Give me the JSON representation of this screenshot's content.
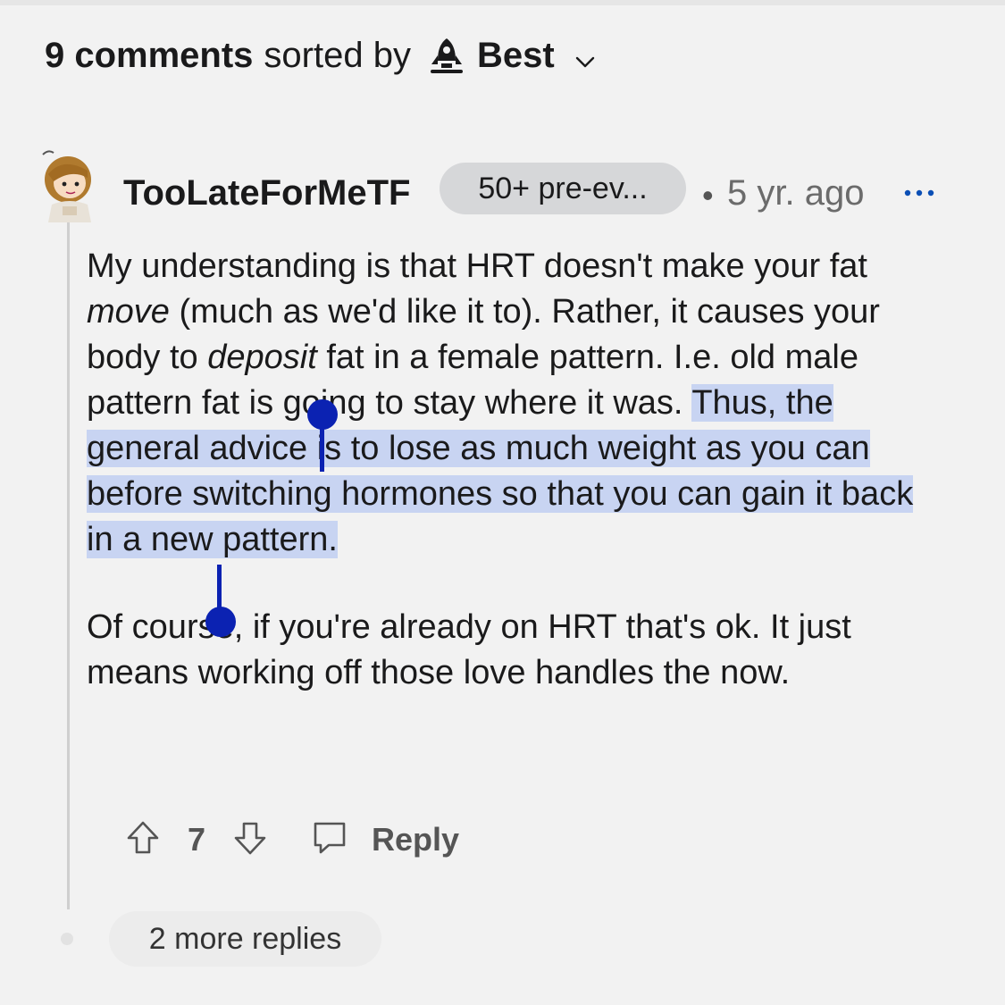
{
  "sort": {
    "count_label": "9 comments",
    "sorted_by_label": "sorted by",
    "icon": "rocket-icon",
    "value": "Best"
  },
  "comment": {
    "author": "TooLateForMeTF",
    "flair": "50+ pre-ev...",
    "separator": "•",
    "timestamp": "5 yr. ago",
    "body": {
      "p1_a": "My understanding is that HRT doesn't make your fat ",
      "p1_b": "move",
      "p1_c": " (much as we'd like it to). Rather, it causes your body to ",
      "p1_d": "deposit",
      "p1_e": " fat in a female pattern. I.e. old male pattern fat is going to stay where it was. ",
      "p1_selected": "Thus, the general advice is to lose as much weight as you can before switching hormones so that you can gain it back in a new pattern.",
      "p2": "Of course, if you're already on HRT that's ok. It just means working off those love handles the now."
    },
    "votes": "7",
    "reply_label": "Reply"
  },
  "more_replies": "2 more replies",
  "colors": {
    "background": "#f2f2f2",
    "selection": "#c8d4f2",
    "selection_handle": "#0b22b2",
    "link_blue": "#0b4fb5"
  }
}
